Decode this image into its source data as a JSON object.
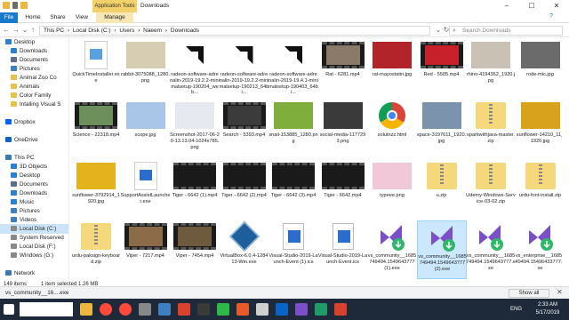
{
  "window": {
    "title": "Downloads",
    "context_tab": "Application Tools",
    "controls": [
      "–",
      "☐",
      "✕"
    ]
  },
  "ribbon": {
    "tabs": [
      "File",
      "Home",
      "Share",
      "View",
      "Manage"
    ]
  },
  "address": {
    "crumbs": [
      "This PC",
      "›",
      "Local Disk (C:)",
      "›",
      "Users",
      "›",
      "Naeem",
      "›",
      "Downloads"
    ],
    "search_placeholder": "Search Downloads"
  },
  "nav": {
    "items": [
      {
        "label": "Desktop",
        "color": "#2a7fd4"
      },
      {
        "label": "Downloads",
        "color": "#2a7fd4"
      },
      {
        "label": "Documents",
        "color": "#5c6f86"
      },
      {
        "label": "Pictures",
        "color": "#3f7fbf"
      },
      {
        "label": "Animal Zoo Co",
        "color": "#e8c04c"
      },
      {
        "label": "Animals",
        "color": "#e8c04c"
      },
      {
        "label": "Color Family",
        "color": "#e8c04c"
      },
      {
        "label": "Intalling Visual S",
        "color": "#e8c04c"
      },
      {
        "label": "",
        "color": "#ffffff"
      },
      {
        "label": "Dropbox",
        "color": "#0061fe"
      },
      {
        "label": "",
        "color": "#ffffff"
      },
      {
        "label": "OneDrive",
        "color": "#0a64c8"
      },
      {
        "label": "",
        "color": "#ffffff"
      },
      {
        "label": "This PC",
        "color": "#3b78b5"
      },
      {
        "label": "3D Objects",
        "color": "#2a7fd4"
      },
      {
        "label": "Desktop",
        "color": "#2a7fd4"
      },
      {
        "label": "Documents",
        "color": "#5c6f86"
      },
      {
        "label": "Downloads",
        "color": "#2a7fd4"
      },
      {
        "label": "Music",
        "color": "#2a7fd4"
      },
      {
        "label": "Pictures",
        "color": "#3f7fbf"
      },
      {
        "label": "Videos",
        "color": "#3f7fbf"
      },
      {
        "label": "Local Disk (C:)",
        "color": "#888888"
      },
      {
        "label": "System Reserved",
        "color": "#888888"
      },
      {
        "label": "Local Disk (F:)",
        "color": "#888888"
      },
      {
        "label": "Windows (G:)",
        "color": "#888888"
      },
      {
        "label": "",
        "color": "#ffffff"
      },
      {
        "label": "Network",
        "color": "#3b78b5"
      }
    ]
  },
  "files": [
    {
      "name": "QuickTimeInstaller.exe",
      "kind": "doc",
      "color": "#5aa0e0"
    },
    {
      "name": "rabbit-3075088_1280.png",
      "kind": "photo",
      "color": "#d7cdb3"
    },
    {
      "name": "radeon-software-adrenalin-2019-19.2.2-minimalsetup-190204_web...",
      "kind": "amd",
      "color": "#111111"
    },
    {
      "name": "radeon-software-adrenalin-2019-19.2.2-minimalsetup-190213_64bi...",
      "kind": "amd",
      "color": "#111111"
    },
    {
      "name": "radeon-software-adrenalin-2019-19.4.1-minimalsetup-190403_64bi...",
      "kind": "amd",
      "color": "#111111"
    },
    {
      "name": "Rat - 6281.mp4",
      "kind": "film",
      "color": "#8b7a6a"
    },
    {
      "name": "rat-mayostatin.jpg",
      "kind": "photo",
      "color": "#b3242a"
    },
    {
      "name": "Red - 5505.mp4",
      "kind": "film",
      "color": "#c8212c"
    },
    {
      "name": "rhino-4194362_1920.jpg",
      "kind": "photo",
      "color": "#c9c2b4"
    },
    {
      "name": "rode-mic.jpg",
      "kind": "photo",
      "color": "#6b6b6b"
    },
    {
      "name": "Science - 22318.mp4",
      "kind": "film",
      "color": "#6d8f5c"
    },
    {
      "name": "scope.jpg",
      "kind": "photo",
      "color": "#a9c6e8"
    },
    {
      "name": "Screenshot-2017-06-20-13.13.04-1024x785.png",
      "kind": "photo",
      "color": "#e6eaf0"
    },
    {
      "name": "Search - 5393.mp4",
      "kind": "film",
      "color": "#3b3b3b"
    },
    {
      "name": "snail-153885_1280.png",
      "kind": "photo",
      "color": "#7fae3c"
    },
    {
      "name": "social-media-1177293.png",
      "kind": "photo",
      "color": "#3a3a3a"
    },
    {
      "name": "solutnzz.html",
      "kind": "chrome",
      "color": "#4285f4"
    },
    {
      "name": "space-3197611_1920.jpg",
      "kind": "photo",
      "color": "#7b93ad"
    },
    {
      "name": "sparkwithjava-master.zip",
      "kind": "zip",
      "color": "#eed38a"
    },
    {
      "name": "sunflower-14210_11_1920.jpg",
      "kind": "photo",
      "color": "#d8a21c"
    },
    {
      "name": "sunflower-3792914_1920.jpg",
      "kind": "photo",
      "color": "#e4b21c"
    },
    {
      "name": "SupportAssistLauncher.exe",
      "kind": "doc",
      "color": "#2b6ccd"
    },
    {
      "name": "Tiger - 6642 (1).mp4",
      "kind": "film",
      "color": "#1a1a1a"
    },
    {
      "name": "Tiger - 6642 (2).mp4",
      "kind": "film",
      "color": "#1a1a1a"
    },
    {
      "name": "Tiger - 6642 (3).mp4",
      "kind": "film",
      "color": "#1a1a1a"
    },
    {
      "name": "Tiger - 6642.mp4",
      "kind": "film",
      "color": "#1a1a1a"
    },
    {
      "name": "typeee.png",
      "kind": "photo",
      "color": "#f0c8d8"
    },
    {
      "name": "u.zip",
      "kind": "zip",
      "color": "#eed38a"
    },
    {
      "name": "Udemy-Windows-Service-03-02.zip",
      "kind": "zip",
      "color": "#eed38a"
    },
    {
      "name": "urdu-font-install.zip",
      "kind": "zip",
      "color": "#eed38a"
    },
    {
      "name": "urdu-paksign-keyboard.zip",
      "kind": "zip",
      "color": "#eed38a"
    },
    {
      "name": "Viper - 7217.mp4",
      "kind": "film",
      "color": "#8c6b48"
    },
    {
      "name": "Viper - 7454.mp4",
      "kind": "film",
      "color": "#6d5a3f"
    },
    {
      "name": "VirtualBox-6.0.4-128413-Win.exe",
      "kind": "vbox",
      "color": "#1f5e9c"
    },
    {
      "name": "Visual-Studio-2019-Launch-Event (1).ics",
      "kind": "cal",
      "color": "#2b6ccd"
    },
    {
      "name": "Visual-Studio-2019-Launch-Event.ics",
      "kind": "cal",
      "color": "#2b6ccd"
    },
    {
      "name": "vs_community__1685749494.1549643777 (1).exe",
      "kind": "vs",
      "color": "#7b4fc8"
    },
    {
      "name": "vs_community__1685749494.1549643777 (2).exe",
      "kind": "vs",
      "color": "#7b4fc8"
    },
    {
      "name": "vs_community__1685749494.1549643777.exe",
      "kind": "vs",
      "color": "#7b4fc8"
    },
    {
      "name": "vs_enterprise__1685749494.15496433777.exe",
      "kind": "vs",
      "color": "#7b4fc8"
    }
  ],
  "status": {
    "count": "149 items",
    "selected": "1 item selected  1.26 MB"
  },
  "download_bar": {
    "item": "vs_community__16....exe",
    "show_all": "Show all",
    "close": "✕"
  },
  "taskbar": {
    "lang": "ENG",
    "time": "2:33 AM",
    "date": "5/17/2019"
  }
}
